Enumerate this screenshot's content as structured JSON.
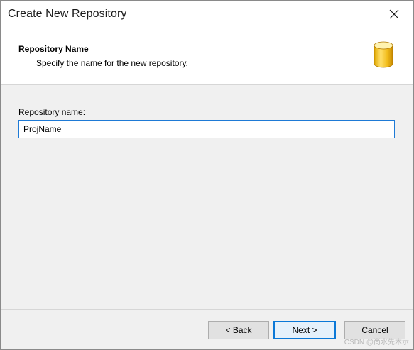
{
  "window": {
    "title": "Create New Repository",
    "close_icon": "close-icon"
  },
  "header": {
    "title": "Repository Name",
    "description": "Specify the name for the new repository.",
    "icon": "database-icon"
  },
  "form": {
    "repository_name": {
      "label_mnemonic": "R",
      "label_rest": "epository name:",
      "value": "ProjName"
    }
  },
  "buttons": {
    "back": {
      "prefix": "< ",
      "mnemonic": "B",
      "rest": "ack"
    },
    "next": {
      "mnemonic": "N",
      "rest": "ext >"
    },
    "cancel": {
      "label": "Cancel"
    }
  },
  "watermark": "CSDN @尚水先木示",
  "colors": {
    "accent": "#0a78d7",
    "input_focus_border": "#1e7ad6",
    "dialog_background": "#f0f0f0"
  }
}
